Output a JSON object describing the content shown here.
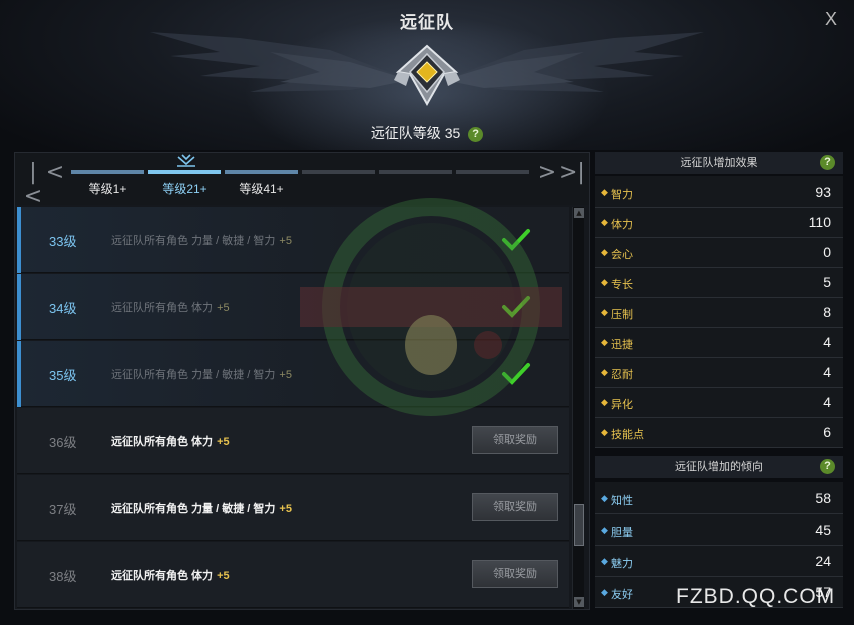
{
  "window": {
    "title": "远征队",
    "close_label": "X"
  },
  "expedition": {
    "level_label": "远征队等级 35",
    "help_label": "?"
  },
  "tabs": [
    {
      "label": "等级1+",
      "state": "active"
    },
    {
      "label": "等级21+",
      "state": "selected"
    },
    {
      "label": "等级41+",
      "state": "active"
    },
    {
      "label": "",
      "state": "inactive"
    },
    {
      "label": "",
      "state": "inactive"
    },
    {
      "label": "",
      "state": "inactive"
    }
  ],
  "nav": {
    "first": "|<",
    "prev": "<",
    "next": ">",
    "last": ">|"
  },
  "rows": [
    {
      "level": "33级",
      "desc": "远征队所有角色 力量 / 敏捷 / 智力",
      "bonus": "+5",
      "status": "claimed"
    },
    {
      "level": "34级",
      "desc": "远征队所有角色 体力",
      "bonus": "+5",
      "status": "claimed"
    },
    {
      "level": "35级",
      "desc": "远征队所有角色 力量 / 敏捷 / 智力",
      "bonus": "+5",
      "status": "claimed"
    },
    {
      "level": "36级",
      "desc": "远征队所有角色 体力",
      "bonus": "+5",
      "status": "unclaimed",
      "button": "领取奖励"
    },
    {
      "level": "37级",
      "desc": "远征队所有角色 力量 / 敏捷 / 智力",
      "bonus": "+5",
      "status": "unclaimed",
      "button": "领取奖励"
    },
    {
      "level": "38级",
      "desc": "远征队所有角色 体力",
      "bonus": "+5",
      "status": "unclaimed",
      "button": "领取奖励"
    }
  ],
  "effects": {
    "title": "远征队增加效果",
    "help": "?",
    "stats": [
      {
        "name": "智力",
        "value": "93"
      },
      {
        "name": "体力",
        "value": "110"
      },
      {
        "name": "会心",
        "value": "0"
      },
      {
        "name": "专长",
        "value": "5"
      },
      {
        "name": "压制",
        "value": "8"
      },
      {
        "name": "迅捷",
        "value": "4"
      },
      {
        "name": "忍耐",
        "value": "4"
      },
      {
        "name": "异化",
        "value": "4"
      },
      {
        "name": "技能点",
        "value": "6"
      }
    ]
  },
  "tendency": {
    "title": "远征队增加的倾向",
    "help": "?",
    "stats": [
      {
        "name": "知性",
        "value": "58"
      },
      {
        "name": "胆量",
        "value": "45"
      },
      {
        "name": "魅力",
        "value": "24"
      },
      {
        "name": "友好",
        "value": "57"
      }
    ]
  },
  "watermarks": {
    "stamp_text": "命运方舟官方作者团",
    "site": "FZBD.QQ.COM"
  },
  "colors": {
    "accent_blue": "#7fc6ee",
    "gold": "#e7c24f",
    "check_green": "#3fcf2a",
    "help_green": "#5b8a2a"
  }
}
